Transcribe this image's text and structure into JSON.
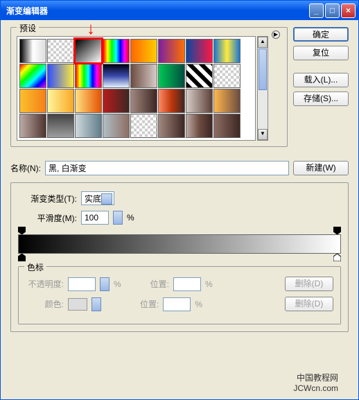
{
  "title": "渐变编辑器",
  "presets_label": "预设",
  "buttons": {
    "ok": "确定",
    "reset": "复位",
    "load": "载入(L)...",
    "save": "存储(S)...",
    "new": "新建(W)"
  },
  "name": {
    "label": "名称(N):",
    "value": "黑, 白渐变"
  },
  "gradient": {
    "type_label": "渐变类型(T):",
    "type_value": "实底",
    "smooth_label": "平滑度(M):",
    "smooth_value": "100",
    "smooth_unit": "%"
  },
  "colorstops": {
    "legend": "色标",
    "opacity_label": "不透明度:",
    "opacity_unit": "%",
    "position_label": "位置:",
    "position_unit": "%",
    "delete_label": "删除(D)",
    "color_label": "颜色:"
  },
  "swatches": [
    {
      "bg": "linear-gradient(to right,#000,#fff,#ddd)"
    },
    {
      "bg": "repeating-conic-gradient(#ccc 0 25%,#fff 0 50%) 0/8px 8px"
    },
    {
      "bg": "linear-gradient(to bottom right,#000,#fff)",
      "selected": true
    },
    {
      "bg": "linear-gradient(to right,#f00,#ff0,#0f0,#0ff,#00f,#f0f,#f00)"
    },
    {
      "bg": "linear-gradient(to right,#ff6600,#ffcc00)"
    },
    {
      "bg": "linear-gradient(to right,#7b1fa2,#ff6f00)"
    },
    {
      "bg": "linear-gradient(to right,#0d47a1,#ff1744)"
    },
    {
      "bg": "linear-gradient(to right,#1976d2,#ffeb3b,#1976d2)"
    },
    {
      "bg": "linear-gradient(135deg,#f00,#ff0,#0f0,#0ff,#00f,#f0f)"
    },
    {
      "bg": "linear-gradient(to right,#304ffe,#ffeb3b)"
    },
    {
      "bg": "linear-gradient(to right,#f00,#ff0,#0f0,#0ff,#00f,#f0f,#f00)"
    },
    {
      "bg": "linear-gradient(to bottom,#001,#3949ab,#e3f2fd)"
    },
    {
      "bg": "linear-gradient(to right,#6d4c41,#d7ccc8)"
    },
    {
      "bg": "linear-gradient(to right,#00c853,#004d40)"
    },
    {
      "bg": "repeating-linear-gradient(45deg,#000 0 6px,#fff 6px 12px)"
    },
    {
      "bg": "repeating-conic-gradient(#ccc 0 25%,#fff 0 50%) 0/8px 8px"
    },
    {
      "bg": "linear-gradient(to right,#fbc02d,#f57f17)"
    },
    {
      "bg": "linear-gradient(to right,#fff59d,#f9a825)"
    },
    {
      "bg": "linear-gradient(to right,#ffe082,#e65100)"
    },
    {
      "bg": "linear-gradient(to right,#b71c1c,#3e2723)"
    },
    {
      "bg": "linear-gradient(to right,#a1887f,#3e2723)"
    },
    {
      "bg": "linear-gradient(to right,#ff8a65,#bf360c,#3e2723)"
    },
    {
      "bg": "linear-gradient(to right,#d7ccc8,#5d4037)"
    },
    {
      "bg": "linear-gradient(to right,#ffb74d,#6d4c41)"
    },
    {
      "bg": "linear-gradient(to right,#bcaaa4,#4e342e)"
    },
    {
      "bg": "linear-gradient(to bottom,#424242,#9e9e9e)"
    },
    {
      "bg": "linear-gradient(to right,#cfd8dc,#607d8b)"
    },
    {
      "bg": "linear-gradient(to right,#b0bec5,#8d6e63)"
    },
    {
      "bg": "repeating-conic-gradient(#ccc 0 25%,#fff 0 50%) 0/8px 8px"
    },
    {
      "bg": "linear-gradient(to right,#a1887f,#3e2723)"
    },
    {
      "bg": "linear-gradient(to right,#bcaaa4,#6d4c41,#3e2723)"
    },
    {
      "bg": "linear-gradient(to right,#8d6e63,#3e2723)"
    }
  ],
  "watermark": {
    "line1": "中国教程网",
    "line2": "JCWcn.com"
  }
}
